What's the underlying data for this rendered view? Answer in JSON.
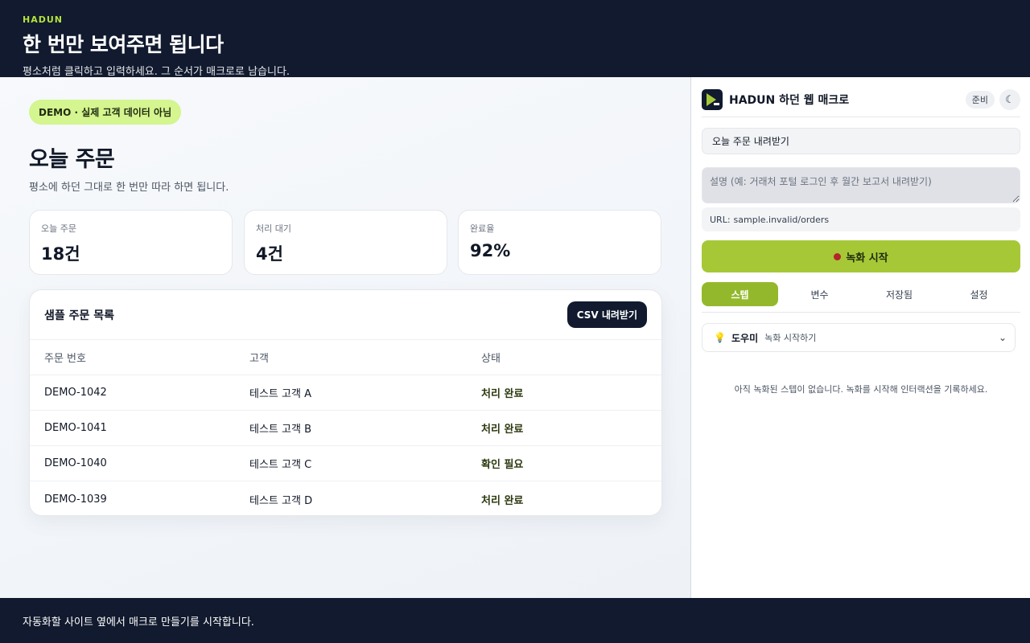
{
  "header": {
    "brand": "HADUN",
    "title": "한 번만 보여주면 됩니다",
    "subtitle": "평소처럼 클릭하고 입력하세요. 그 순서가 매크로로 남습니다."
  },
  "site": {
    "demo_badge": "DEMO · 실제 고객 데이터 아님",
    "title": "오늘 주문",
    "description": "평소에 하던 그대로 한 번만 따라 하면 됩니다.",
    "stats": [
      {
        "label": "오늘 주문",
        "value": "18건"
      },
      {
        "label": "처리 대기",
        "value": "4건"
      },
      {
        "label": "완료율",
        "value": "92%"
      }
    ],
    "orders": {
      "title": "샘플 주문 목록",
      "csv_button": "CSV 내려받기",
      "columns": [
        "주문 번호",
        "고객",
        "상태"
      ],
      "rows": [
        {
          "id": "DEMO-1042",
          "customer": "테스트 고객 A",
          "status": "처리 완료"
        },
        {
          "id": "DEMO-1041",
          "customer": "테스트 고객 B",
          "status": "처리 완료"
        },
        {
          "id": "DEMO-1040",
          "customer": "테스트 고객 C",
          "status": "확인 필요"
        },
        {
          "id": "DEMO-1039",
          "customer": "테스트 고객 D",
          "status": "처리 완료"
        }
      ]
    }
  },
  "panel": {
    "title": "HADUN 하던 웹 매크로",
    "status_badge": "준비",
    "theme_toggle_glyph": "☾",
    "macro_name": "오늘 주문 내려받기",
    "description_placeholder": "설명 (예: 거래처 포털 로그인 후 월간 보고서 내려받기)",
    "url_label": "URL:",
    "url_value": "sample.invalid/orders",
    "record_button": "녹화 시작",
    "tabs": [
      "스텝",
      "변수",
      "저장됨",
      "설정"
    ],
    "active_tab": "스텝",
    "helper": {
      "icon": "lightbulb-icon",
      "name": "도우미",
      "description": "녹화 시작하기"
    },
    "empty_message": "아직 녹화된 스텝이 없습니다. 녹화를 시작해 인터랙션을 기록하세요."
  },
  "footer": {
    "text": "자동화할 사이트 옆에서 매크로 만들기를 시작합니다."
  },
  "colors": {
    "navy": "#111a2e",
    "accent_green": "#a6c837",
    "badge_green": "#d4f58f",
    "record_dot": "#b3262b"
  }
}
